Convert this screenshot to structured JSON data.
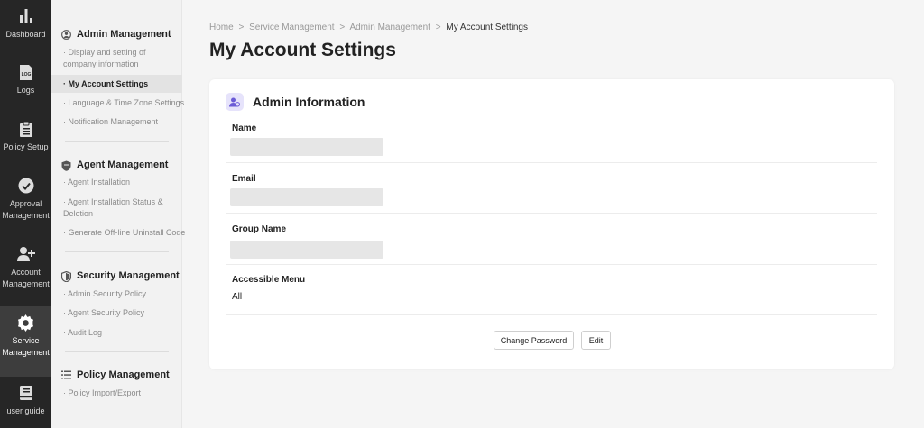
{
  "rail": [
    {
      "id": "dashboard",
      "label": "Dashboard",
      "icon": "bar-chart-icon"
    },
    {
      "id": "logs",
      "label": "Logs",
      "icon": "log-file-icon"
    },
    {
      "id": "policy",
      "label": "Policy Setup",
      "icon": "clipboard-icon"
    },
    {
      "id": "approval",
      "label": "Approval Management",
      "icon": "check-circle-icon"
    },
    {
      "id": "account",
      "label": "Account Management",
      "icon": "add-user-icon"
    },
    {
      "id": "service",
      "label": "Service Management",
      "icon": "gear-icon",
      "active": true
    },
    {
      "id": "guide",
      "label": "user guide",
      "icon": "book-icon"
    }
  ],
  "menu": {
    "admin": {
      "title": "Admin Management",
      "items": [
        "· Display and setting of company information",
        "· My Account Settings",
        "· Language & Time Zone Settings",
        "· Notification Management"
      ]
    },
    "agent": {
      "title": "Agent Management",
      "items": [
        "· Agent Installation",
        "· Agent Installation Status & Deletion",
        "· Generate Off-line Uninstall Code"
      ]
    },
    "security": {
      "title": "Security Management",
      "items": [
        "· Admin Security Policy",
        "· Agent Security Policy",
        "· Audit Log"
      ]
    },
    "policy": {
      "title": "Policy Management",
      "items": [
        "· Policy Import/Export"
      ]
    }
  },
  "breadcrumb": {
    "home": "Home",
    "sep": ">",
    "service": "Service Management",
    "admin": "Admin Management",
    "current": "My Account Settings"
  },
  "page_title": "My Account Settings",
  "card": {
    "title": "Admin Information",
    "name_label": "Name",
    "email_label": "Email",
    "group_label": "Group Name",
    "menu_label": "Accessible Menu",
    "menu_value": "All",
    "change_password": "Change Password",
    "edit": "Edit"
  },
  "colors": {
    "rail_bg": "#262626",
    "accent_icon_bg": "#e6e3fb",
    "accent_icon_fg": "#6b5bd6"
  }
}
